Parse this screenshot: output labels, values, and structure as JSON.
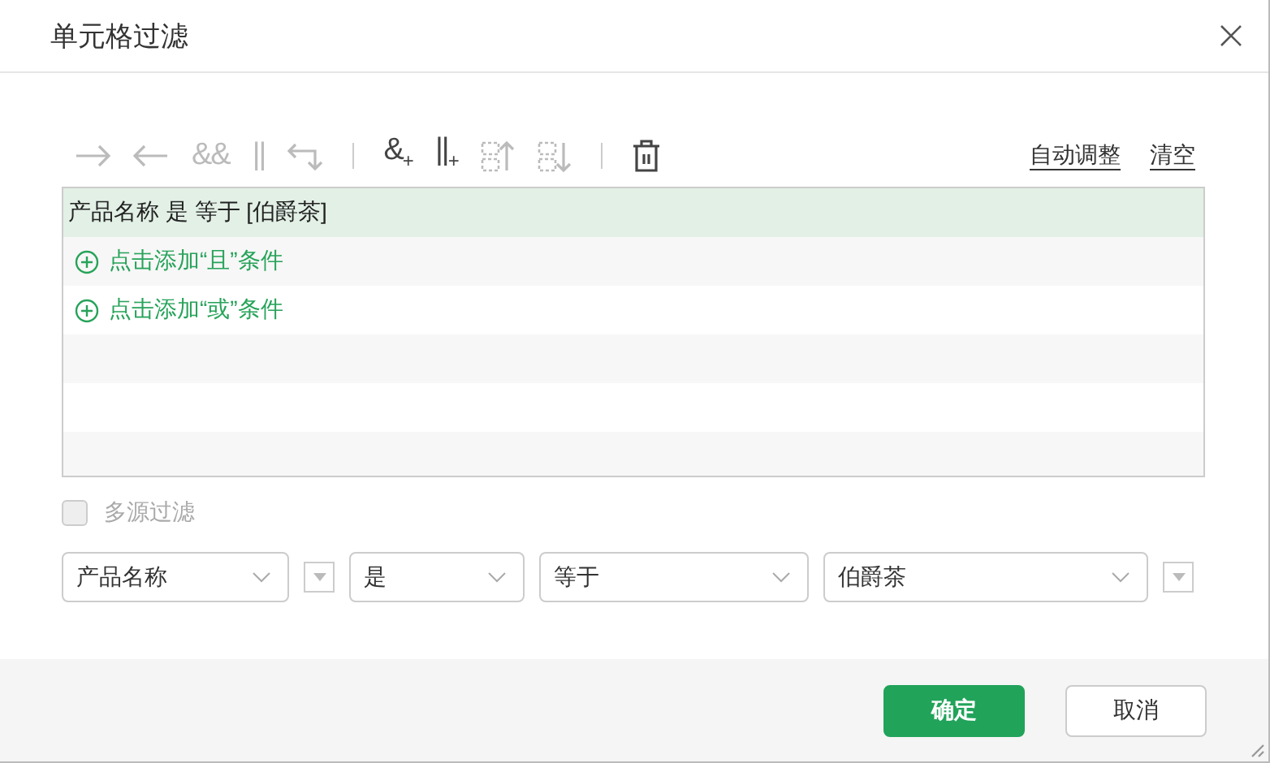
{
  "window": {
    "title": "单元格过滤"
  },
  "toolbar": [
    {
      "kind": "arrow-right",
      "disabled": true
    },
    {
      "kind": "arrow-left",
      "disabled": true
    },
    {
      "kind": "glyph",
      "text": "&&",
      "disabled": true
    },
    {
      "kind": "glyph",
      "text": "||",
      "disabled": true
    },
    {
      "kind": "return",
      "disabled": true
    },
    {
      "kind": "separator"
    },
    {
      "kind": "glyph",
      "text": "&$_{+}$",
      "disabled": false
    },
    {
      "kind": "glyph",
      "text": "||$_{+}$",
      "disabled": false
    },
    {
      "kind": "move-up",
      "disabled": true
    },
    {
      "kind": "move-down",
      "disabled": true
    },
    {
      "kind": "separator"
    },
    {
      "kind": "delete",
      "disabled": false
    }
  ],
  "links": [
    "自动调整",
    "清空"
  ],
  "conditions": [
    {
      "kind": "condition",
      "text": "产品名称 是 等于 [伯爵茶]",
      "selected": true
    },
    {
      "kind": "add",
      "text": "点击添加“且”条件",
      "selected": false
    },
    {
      "kind": "add",
      "text": "点击添加“或”条件",
      "selected": false
    }
  ],
  "multi_source": {
    "label": "多源过滤",
    "checked": false,
    "disabled": true
  },
  "filters": [
    {
      "kind": "select",
      "value": "产品名称"
    },
    {
      "kind": "mini"
    },
    {
      "kind": "select",
      "value": "是"
    },
    {
      "kind": "select",
      "value": "等于"
    },
    {
      "kind": "select",
      "value": "伯爵茶"
    },
    {
      "kind": "mini"
    }
  ],
  "buttons": [
    {
      "label": "确定",
      "primary": true
    },
    {
      "label": "取消",
      "primary": false
    }
  ]
}
